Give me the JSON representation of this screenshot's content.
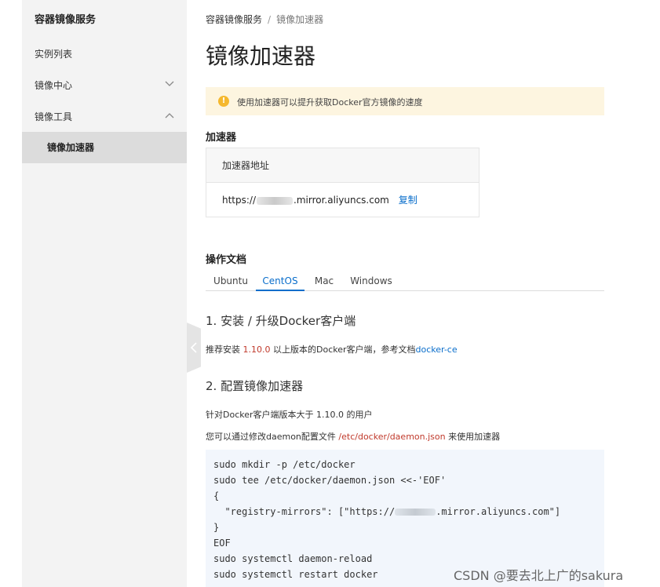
{
  "sidebar": {
    "title": "容器镜像服务",
    "items": [
      {
        "label": "实例列表"
      },
      {
        "label": "镜像中心",
        "chevron": "chevron-down"
      },
      {
        "label": "镜像工具",
        "chevron": "chevron-up"
      },
      {
        "label": "镜像加速器"
      }
    ]
  },
  "breadcrumb": {
    "root": "容器镜像服务",
    "separator": "/",
    "current": "镜像加速器"
  },
  "page_title": "镜像加速器",
  "notice": {
    "icon": "warning-icon",
    "text": "使用加速器可以提升获取Docker官方镜像的速度",
    "color": "#fdf5e0"
  },
  "accelerator": {
    "section_label": "加速器",
    "column_header": "加速器地址",
    "address_prefix": "https://",
    "address_suffix": ".mirror.aliyuncs.com",
    "copy_label": "复制"
  },
  "docs": {
    "section_label": "操作文档",
    "tabs": [
      {
        "label": "Ubuntu",
        "active": false
      },
      {
        "label": "CentOS",
        "active": true
      },
      {
        "label": "Mac",
        "active": false
      },
      {
        "label": "Windows",
        "active": false
      }
    ],
    "step1": {
      "heading": "1. 安装 / 升级Docker客户端",
      "text_before": "推荐安装",
      "version": "1.10.0",
      "text_middle": "以上版本的Docker客户端，参考文档",
      "link": "docker-ce"
    },
    "step2": {
      "heading": "2. 配置镜像加速器",
      "line1": "针对Docker客户端版本大于 1.10.0 的用户",
      "line2_before": "您可以通过修改daemon配置文件",
      "line2_path": "/etc/docker/daemon.json",
      "line2_after": "来使用加速器"
    },
    "code": {
      "lines": [
        "sudo mkdir -p /etc/docker",
        "sudo tee /etc/docker/daemon.json <<-'EOF'",
        "{",
        "  \"registry-mirrors\": [\"https://",
        "}",
        "EOF",
        "sudo systemctl daemon-reload",
        "sudo systemctl restart docker"
      ],
      "mirror_suffix": ".mirror.aliyuncs.com\"]"
    }
  },
  "watermark": "CSDN @要去北上广的sakura",
  "colors": {
    "accent": "#0a6ecb",
    "version_red": "#c0392b",
    "sidebar_bg": "#f3f3f3",
    "code_bg": "#f2f6fc"
  }
}
